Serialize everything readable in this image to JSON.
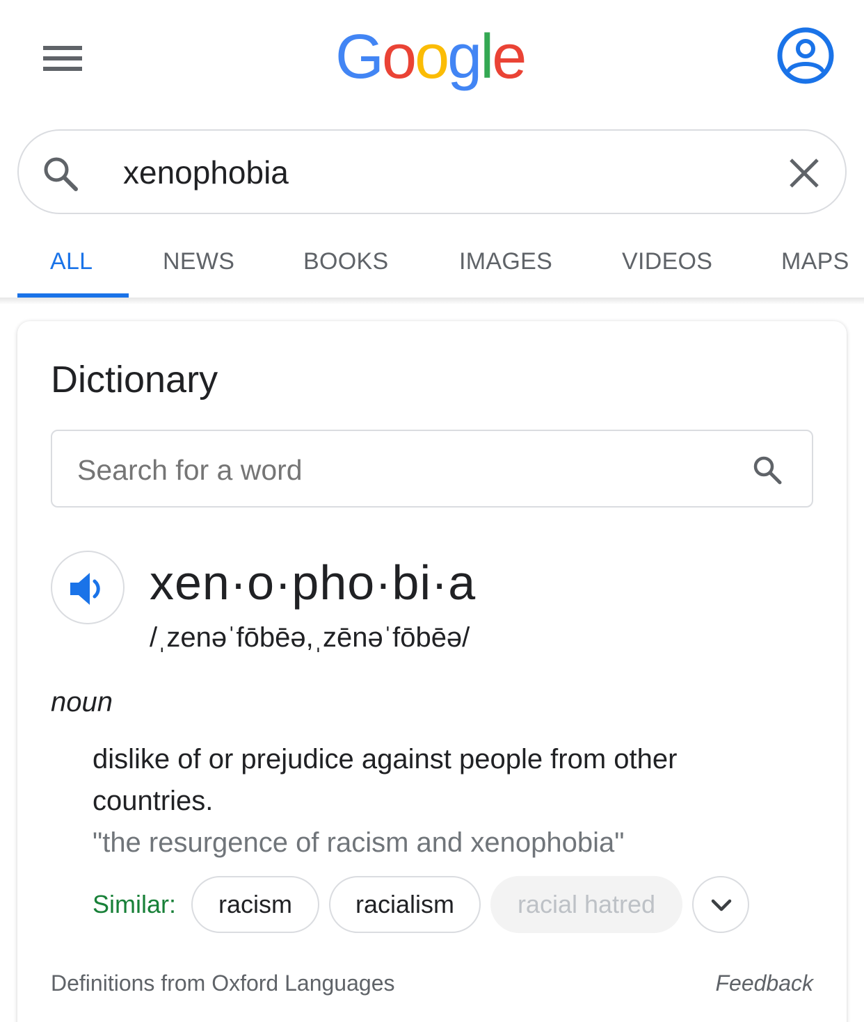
{
  "header": {
    "logo_letters": [
      "G",
      "o",
      "o",
      "g",
      "l",
      "e"
    ],
    "logo_colors": [
      "#4285F4",
      "#EA4335",
      "#FBBC05",
      "#4285F4",
      "#34A853",
      "#EA4335"
    ]
  },
  "search": {
    "query": "xenophobia"
  },
  "tabs": [
    {
      "label": "ALL",
      "active": true
    },
    {
      "label": "NEWS",
      "active": false
    },
    {
      "label": "BOOKS",
      "active": false
    },
    {
      "label": "IMAGES",
      "active": false
    },
    {
      "label": "VIDEOS",
      "active": false
    },
    {
      "label": "MAPS",
      "active": false
    }
  ],
  "dictionary": {
    "title": "Dictionary",
    "search_placeholder": "Search for a word",
    "headword": "xen·o·pho·bi·a",
    "phonetic": "/ˌzenəˈfōbēə,ˌzēnəˈfōbēə/",
    "part_of_speech": "noun",
    "definition": "dislike of or prejudice against people from other countries.",
    "example": "\"the resurgence of racism and xenophobia\"",
    "similar_label": "Similar:",
    "similar": [
      "racism",
      "racialism",
      "racial hatred"
    ],
    "source": "Definitions from Oxford Languages",
    "feedback": "Feedback"
  },
  "colors": {
    "accent": "#1a73e8",
    "similar_label": "#188038",
    "muted_text": "#70757a"
  }
}
